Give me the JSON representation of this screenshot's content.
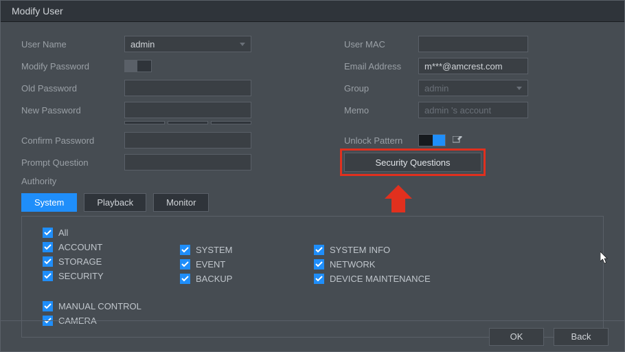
{
  "window": {
    "title": "Modify User"
  },
  "fields": {
    "user_name_label": "User Name",
    "user_name_value": "admin",
    "modify_password_label": "Modify Password",
    "old_password_label": "Old Password",
    "old_password_value": "",
    "new_password_label": "New Password",
    "new_password_value": "",
    "confirm_password_label": "Confirm Password",
    "confirm_password_value": "",
    "prompt_question_label": "Prompt Question",
    "prompt_question_value": "",
    "user_mac_label": "User MAC",
    "user_mac_value": "",
    "email_label": "Email Address",
    "email_value": "m***@amcrest.com",
    "group_label": "Group",
    "group_value": "admin",
    "memo_label": "Memo",
    "memo_placeholder": "admin 's account",
    "unlock_pattern_label": "Unlock Pattern",
    "security_questions_label": "Security Questions"
  },
  "toggles": {
    "modify_password": false,
    "unlock_pattern": true
  },
  "authority": {
    "label": "Authority",
    "tabs": [
      "System",
      "Playback",
      "Monitor"
    ],
    "active_tab": "System",
    "columns": [
      [
        "All",
        "ACCOUNT",
        "STORAGE",
        "SECURITY"
      ],
      [
        "SYSTEM",
        "EVENT",
        "BACKUP"
      ],
      [
        "SYSTEM INFO",
        "NETWORK",
        "DEVICE MAINTENANCE"
      ],
      [
        "MANUAL CONTROL",
        "CAMERA"
      ]
    ]
  },
  "footer": {
    "ok": "OK",
    "back": "Back"
  }
}
